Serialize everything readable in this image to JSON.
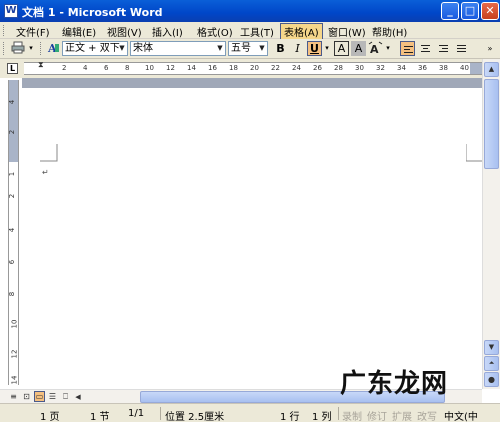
{
  "window": {
    "title": "文档 1 - Microsoft Word",
    "app_icon_letter": "W",
    "minimize_glyph": "_",
    "maximize_glyph": "□",
    "close_glyph": "✕"
  },
  "menu": {
    "items": [
      "文件(F)",
      "编辑(E)",
      "视图(V)",
      "插入(I)",
      "格式(O)",
      "工具(T)",
      "表格(A)",
      "窗口(W)",
      "帮助(H)"
    ],
    "active_index": 6
  },
  "toolbar": {
    "style_value": "正文 + 双下",
    "font_value": "宋体",
    "size_value": "五号",
    "bold": "B",
    "italic": "I",
    "underline": "U",
    "char_border": "A",
    "char_shading": "A",
    "font_color": "A"
  },
  "ruler": {
    "corner_symbol": "L",
    "h_ticks": [
      "2",
      "4",
      "6",
      "8",
      "10",
      "12",
      "14",
      "16",
      "18",
      "20",
      "22",
      "24",
      "26",
      "28",
      "30",
      "32",
      "34",
      "36",
      "38",
      "40"
    ],
    "v_ticks": [
      "4",
      "2",
      "1",
      "2",
      "4",
      "6",
      "8",
      "10",
      "12",
      "14"
    ]
  },
  "document": {
    "paragraph_mark": "↵"
  },
  "status": {
    "page": "1 页",
    "section": "1 节",
    "pages": "1/1",
    "position": "位置 2.5厘米",
    "line": "1 行",
    "column": "1 列",
    "rec": "录制",
    "trk": "修订",
    "ext": "扩展",
    "ovr": "改写",
    "language": "中文(中"
  },
  "watermark": "广东龙网",
  "colors": {
    "titlebar": "#0046c8",
    "chrome": "#ece9d8",
    "active_menu": "#f5d68a"
  }
}
